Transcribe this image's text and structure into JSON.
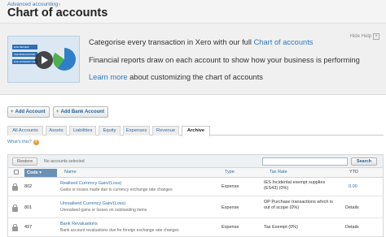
{
  "header": {
    "breadcrumb": "Advanced accounting",
    "breadcrumb_sep": "›",
    "title": "Chart of accounts"
  },
  "banner": {
    "line1_prefix": "Categorise every transaction in Xero with our full ",
    "line1_link": "Chart of accounts",
    "line2": "Financial reports draw on each account to show how your business is performing",
    "line3_link": "Learn more",
    "line3_suffix": " about customizing the chart of accounts",
    "hide_help": "Hide Help",
    "video_bars": [
      "EXE REVIEW",
      "FEE BREAKDOWN",
      "EXE EXPENDITURE"
    ]
  },
  "actions": {
    "add_account": "Add Account",
    "add_bank_account": "Add Bank Account"
  },
  "tabs": [
    "All Accounts",
    "Assets",
    "Liabilities",
    "Equity",
    "Expenses",
    "Revenue",
    "Archive"
  ],
  "active_tab": "Archive",
  "whats_this": "What's this?",
  "toolbar": {
    "restore": "Restore",
    "selected_note": "No accounts selected",
    "search_placeholder": "",
    "search_button": "Search"
  },
  "columns": {
    "code": "Code ▾",
    "name": "Name",
    "type": "Type",
    "tax_rate": "Tax Rate",
    "ytd": "YTD"
  },
  "rows": [
    {
      "code": "802",
      "name": "Realised Currency Gain/(Loss)",
      "description": "Gains or losses made due to currency exchange rate changes",
      "type": "Expense",
      "tax_rate": "IES Incidental exempt supplies (ES43) (0%)",
      "ytd": "0.00"
    },
    {
      "code": "801",
      "name": "Unrealised Currency Gain/(Loss)",
      "description": "Unrealised gains or losses on outstanding items",
      "type": "Expense",
      "tax_rate": "OP Purchase transactions which is out of scope (0%)",
      "ytd": "Details"
    },
    {
      "code": "497",
      "name": "Bank Revaluations",
      "description": "Bank account revaluations due for foreign exchange rate changes",
      "type": "Expense",
      "tax_rate": "Tax Exempt (0%)",
      "ytd": "Details"
    }
  ],
  "colors": {
    "link": "#2e6da4",
    "sorted_header": "#6b8fb5",
    "banner_bg": "#f0f0f0",
    "play_button": "#282828"
  }
}
